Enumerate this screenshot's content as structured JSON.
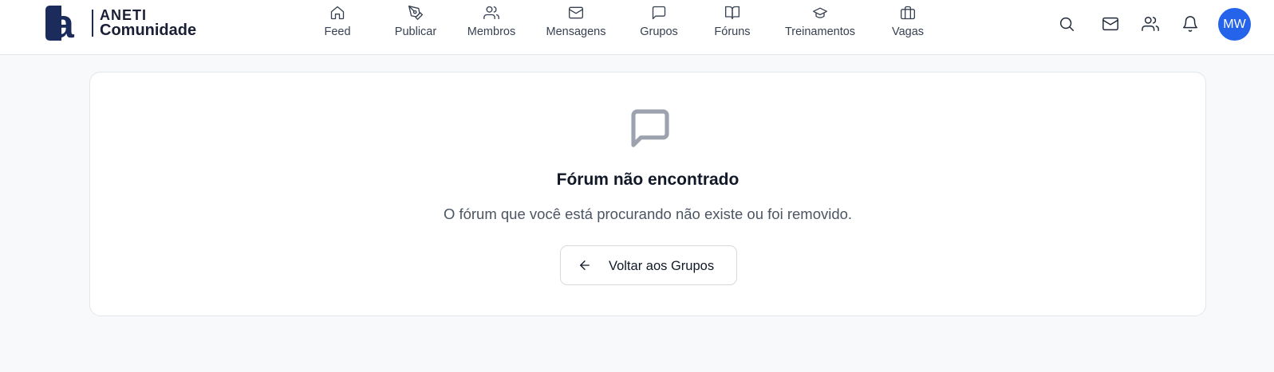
{
  "brand": {
    "line1": "ANETI",
    "line2": "Comunidade",
    "colors": {
      "primary": "#1a2b5c",
      "accent": "#2563eb"
    }
  },
  "nav": {
    "items": [
      {
        "label": "Feed",
        "icon": "home-icon"
      },
      {
        "label": "Publicar",
        "icon": "pen-tool-icon"
      },
      {
        "label": "Membros",
        "icon": "users-icon"
      },
      {
        "label": "Mensagens",
        "icon": "mail-icon"
      },
      {
        "label": "Grupos",
        "icon": "message-square-icon"
      },
      {
        "label": "Fóruns",
        "icon": "book-open-icon"
      },
      {
        "label": "Treinamentos",
        "icon": "graduation-cap-icon"
      },
      {
        "label": "Vagas",
        "icon": "briefcase-icon"
      }
    ]
  },
  "header_actions": {
    "icons": [
      "search-icon",
      "mail-icon",
      "users-icon",
      "bell-icon"
    ],
    "avatar_initials": "MW"
  },
  "main": {
    "icon": "message-square-icon",
    "title": "Fórum não encontrado",
    "description": "O fórum que você está procurando não existe ou foi removido.",
    "back_button": {
      "label": "Voltar aos Grupos",
      "icon": "arrow-left-icon"
    }
  }
}
